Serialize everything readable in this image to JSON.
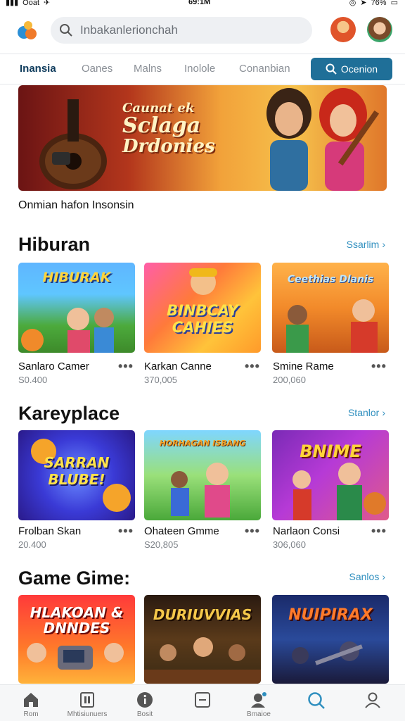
{
  "status": {
    "carrier": "Ooat",
    "time": "69:1M",
    "battery": "76%"
  },
  "header": {
    "search_placeholder": "Inbakanlerionchah"
  },
  "tabs": [
    {
      "label": "Inansia",
      "active": true
    },
    {
      "label": "Oanes",
      "active": false
    },
    {
      "label": "Malns",
      "active": false
    },
    {
      "label": "Inolole",
      "active": false
    },
    {
      "label": "Conanbian",
      "active": false
    }
  ],
  "tab_button": {
    "label": "Ocenion"
  },
  "banner": {
    "line1": "Caunat ek",
    "line2": "Sclaga",
    "line3": "Drdonies",
    "caption": "Onmian hafon Insonsin"
  },
  "sections": [
    {
      "title": "Hiburan",
      "see_all": "Ssarlim",
      "cards": [
        {
          "art": "HIBURAK",
          "title": "Sanlaro Camer",
          "sub": "S0.400",
          "more": "•••"
        },
        {
          "art": "BINBCAY CAHIES",
          "title": "Karkan Canne",
          "sub": "370,005",
          "more": "•••"
        },
        {
          "art": "Ceethias Dlanis",
          "title": "Smine Rame",
          "sub": "200,060",
          "more": "•••"
        }
      ]
    },
    {
      "title": "Kareyplace",
      "see_all": "Stanlor",
      "cards": [
        {
          "art": "SARRAN BLUBE!",
          "title": "Frolban Skan",
          "sub": "20.400",
          "more": "•••"
        },
        {
          "art": "HORHAGAN ISBANG",
          "title": "Ohateen Gmme",
          "sub": "S20,805",
          "more": "•••"
        },
        {
          "art": "BNIME",
          "title": "Narlaon Consi",
          "sub": "306,060",
          "more": "•••"
        }
      ]
    },
    {
      "title": "Game Gime:",
      "see_all": "Sanlos",
      "cards": [
        {
          "art": "HLAKOAN & DNNDES",
          "title": "",
          "sub": "",
          "more": ""
        },
        {
          "art": "DURIUVVIAS",
          "title": "",
          "sub": "",
          "more": ""
        },
        {
          "art": "NUIPIRAX",
          "title": "",
          "sub": "",
          "more": ""
        }
      ]
    }
  ],
  "bottom_nav": [
    {
      "label": "Rom",
      "icon": "home-icon"
    },
    {
      "label": "Mhtisiunuers",
      "icon": "library-icon"
    },
    {
      "label": "Bosit",
      "icon": "info-icon"
    },
    {
      "label": "",
      "icon": "minus-box-icon"
    },
    {
      "label": "Bmaioe",
      "icon": "profile-notify-icon"
    },
    {
      "label": "",
      "icon": "search-icon"
    },
    {
      "label": "",
      "icon": "person-icon"
    }
  ]
}
